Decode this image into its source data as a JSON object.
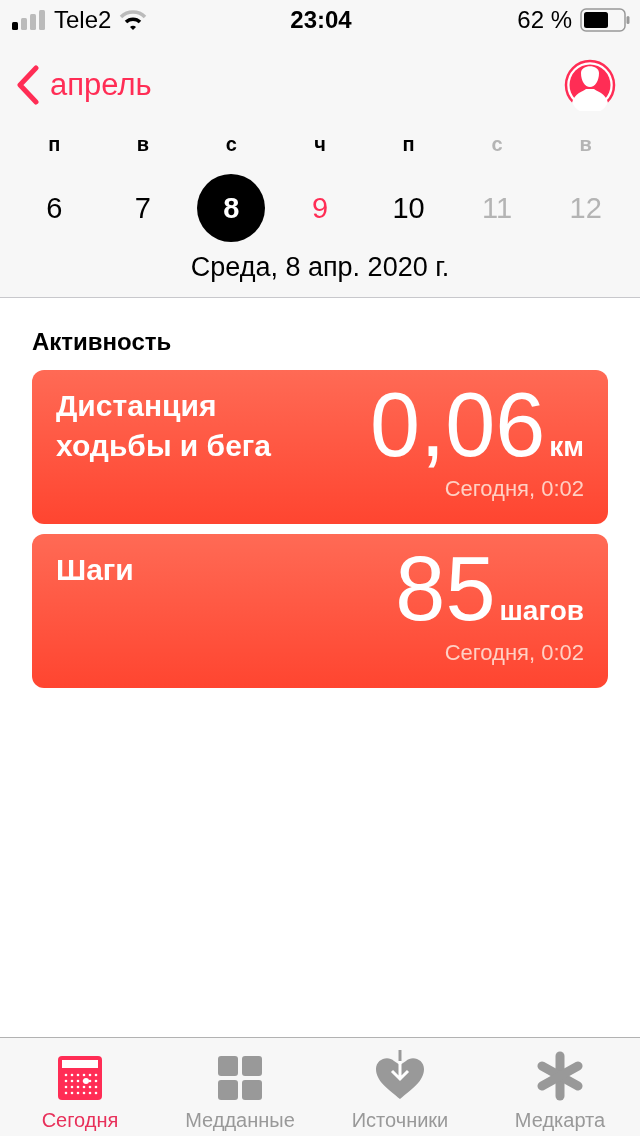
{
  "status_bar": {
    "carrier": "Tele2",
    "time": "23:04",
    "battery_text": "62 %"
  },
  "nav": {
    "back_label": "апрель"
  },
  "weekdays": [
    {
      "label": "п",
      "weekend": false
    },
    {
      "label": "в",
      "weekend": false
    },
    {
      "label": "с",
      "weekend": false
    },
    {
      "label": "ч",
      "weekend": false
    },
    {
      "label": "п",
      "weekend": false
    },
    {
      "label": "с",
      "weekend": true
    },
    {
      "label": "в",
      "weekend": true
    }
  ],
  "days": [
    {
      "label": "6",
      "selected": false,
      "today": false,
      "future": false
    },
    {
      "label": "7",
      "selected": false,
      "today": false,
      "future": false
    },
    {
      "label": "8",
      "selected": true,
      "today": false,
      "future": false
    },
    {
      "label": "9",
      "selected": false,
      "today": true,
      "future": false
    },
    {
      "label": "10",
      "selected": false,
      "today": false,
      "future": false
    },
    {
      "label": "11",
      "selected": false,
      "today": false,
      "future": true
    },
    {
      "label": "12",
      "selected": false,
      "today": false,
      "future": true
    }
  ],
  "date_title": "Среда, 8 апр. 2020 г.",
  "section_title": "Активность",
  "cards": [
    {
      "title": "Дистанция ходьбы и бега",
      "value": "0,06",
      "unit": "км",
      "time": "Сегодня, 0:02"
    },
    {
      "title": "Шаги",
      "value": "85",
      "unit": "шагов",
      "time": "Сегодня, 0:02"
    }
  ],
  "tabs": [
    {
      "label": "Сегодня",
      "kind": "calendar",
      "selected": true
    },
    {
      "label": "Медданные",
      "kind": "grid",
      "selected": false
    },
    {
      "label": "Источники",
      "kind": "heart",
      "selected": false
    },
    {
      "label": "Медкарта",
      "kind": "asterisk",
      "selected": false
    }
  ]
}
